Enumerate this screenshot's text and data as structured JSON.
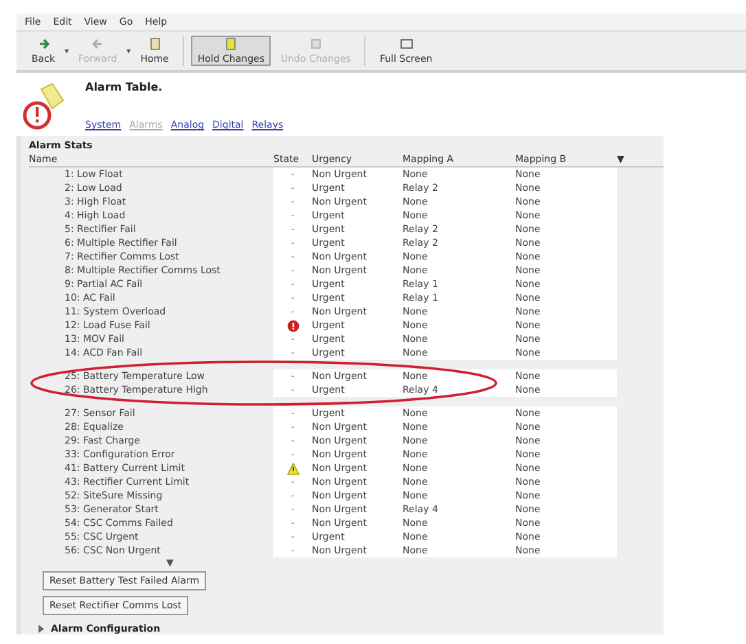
{
  "menu": [
    "File",
    "Edit",
    "View",
    "Go",
    "Help"
  ],
  "toolbar": [
    {
      "kind": "back",
      "label": "Back",
      "disabled": false,
      "pressed": false,
      "dropdown": "▾"
    },
    {
      "kind": "forward",
      "label": "Forward",
      "disabled": true,
      "pressed": false,
      "dropdown": "▾"
    },
    {
      "kind": "home",
      "label": "Home",
      "disabled": false,
      "pressed": false
    },
    {
      "kind": "hold",
      "label": "Hold Changes",
      "disabled": false,
      "pressed": true
    },
    {
      "kind": "undo",
      "label": "Undo Changes",
      "disabled": true,
      "pressed": false
    },
    {
      "kind": "fullscreen",
      "label": "Full Screen",
      "disabled": false,
      "pressed": false
    }
  ],
  "page": {
    "title": "Alarm Table.",
    "links": [
      {
        "label": "System",
        "selected": false
      },
      {
        "label": "Alarms",
        "selected": true
      },
      {
        "label": "Analog",
        "selected": false
      },
      {
        "label": "Digital",
        "selected": false
      },
      {
        "label": "Relays",
        "selected": false
      }
    ]
  },
  "section": "Alarm Stats",
  "columns": [
    "Name",
    "State",
    "Urgency",
    "Mapping A",
    "Mapping B"
  ],
  "sort_marker": "▼",
  "rows": [
    {
      "name": "1: Low Float",
      "kind": "text",
      "state": "-",
      "urgency": "Non Urgent",
      "mapping_a": "None",
      "mapping_b": "None",
      "circled": false
    },
    {
      "name": "2: Low Load",
      "kind": "text",
      "state": "-",
      "urgency": "Urgent",
      "mapping_a": "Relay 2",
      "mapping_b": "None",
      "circled": false
    },
    {
      "name": "3: High Float",
      "kind": "text",
      "state": "-",
      "urgency": "Non Urgent",
      "mapping_a": "None",
      "mapping_b": "None",
      "circled": false
    },
    {
      "name": "4: High Load",
      "kind": "text",
      "state": "-",
      "urgency": "Urgent",
      "mapping_a": "None",
      "mapping_b": "None",
      "circled": false
    },
    {
      "name": "5: Rectifier Fail",
      "kind": "text",
      "state": "-",
      "urgency": "Urgent",
      "mapping_a": "Relay 2",
      "mapping_b": "None",
      "circled": false
    },
    {
      "name": "6: Multiple Rectifier Fail",
      "kind": "text",
      "state": "-",
      "urgency": "Urgent",
      "mapping_a": "Relay 2",
      "mapping_b": "None",
      "circled": false
    },
    {
      "name": "7: Rectifier Comms Lost",
      "kind": "text",
      "state": "-",
      "urgency": "Non Urgent",
      "mapping_a": "None",
      "mapping_b": "None",
      "circled": false
    },
    {
      "name": "8: Multiple Rectifier Comms Lost",
      "kind": "text",
      "state": "-",
      "urgency": "Non Urgent",
      "mapping_a": "None",
      "mapping_b": "None",
      "circled": false
    },
    {
      "name": "9: Partial AC Fail",
      "kind": "text",
      "state": "-",
      "urgency": "Urgent",
      "mapping_a": "Relay 1",
      "mapping_b": "None",
      "circled": false
    },
    {
      "name": "10: AC Fail",
      "kind": "text",
      "state": "-",
      "urgency": "Urgent",
      "mapping_a": "Relay 1",
      "mapping_b": "None",
      "circled": false
    },
    {
      "name": "11: System Overload",
      "kind": "text",
      "state": "-",
      "urgency": "Non Urgent",
      "mapping_a": "None",
      "mapping_b": "None",
      "circled": false
    },
    {
      "name": "12: Load Fuse Fail",
      "kind": "alarm",
      "urgency": "Urgent",
      "mapping_a": "None",
      "mapping_b": "None",
      "circled": false
    },
    {
      "name": "13: MOV Fail",
      "kind": "text",
      "state": "-",
      "urgency": "Urgent",
      "mapping_a": "None",
      "mapping_b": "None",
      "circled": false
    },
    {
      "name": "14: ACD Fan Fail",
      "kind": "text",
      "state": "-",
      "urgency": "Urgent",
      "mapping_a": "None",
      "mapping_b": "None",
      "circled": false
    },
    {
      "name": "25: Battery Temperature Low",
      "kind": "text",
      "state": "-",
      "urgency": "Non Urgent",
      "mapping_a": "None",
      "mapping_b": "None",
      "circled": true
    },
    {
      "name": "26: Battery Temperature High",
      "kind": "text",
      "state": "-",
      "urgency": "Urgent",
      "mapping_a": "Relay 4",
      "mapping_b": "None",
      "circled": true
    },
    {
      "name": "27: Sensor Fail",
      "kind": "text",
      "state": "-",
      "urgency": "Urgent",
      "mapping_a": "None",
      "mapping_b": "None",
      "circled": false
    },
    {
      "name": "28: Equalize",
      "kind": "text",
      "state": "-",
      "urgency": "Non Urgent",
      "mapping_a": "None",
      "mapping_b": "None",
      "circled": false
    },
    {
      "name": "29: Fast Charge",
      "kind": "text",
      "state": "-",
      "urgency": "Non Urgent",
      "mapping_a": "None",
      "mapping_b": "None",
      "circled": false
    },
    {
      "name": "33: Configuration Error",
      "kind": "text",
      "state": "-",
      "urgency": "Non Urgent",
      "mapping_a": "None",
      "mapping_b": "None",
      "circled": false
    },
    {
      "name": "41: Battery Current Limit",
      "kind": "warning",
      "urgency": "Non Urgent",
      "mapping_a": "None",
      "mapping_b": "None",
      "circled": false
    },
    {
      "name": "43: Rectifier Current Limit",
      "kind": "text",
      "state": "-",
      "urgency": "Non Urgent",
      "mapping_a": "None",
      "mapping_b": "None",
      "circled": false
    },
    {
      "name": "52: SiteSure Missing",
      "kind": "text",
      "state": "-",
      "urgency": "Non Urgent",
      "mapping_a": "None",
      "mapping_b": "None",
      "circled": false
    },
    {
      "name": "53: Generator Start",
      "kind": "text",
      "state": "-",
      "urgency": "Non Urgent",
      "mapping_a": "Relay 4",
      "mapping_b": "None",
      "circled": false
    },
    {
      "name": "54: CSC Comms Failed",
      "kind": "text",
      "state": "-",
      "urgency": "Non Urgent",
      "mapping_a": "None",
      "mapping_b": "None",
      "circled": false
    },
    {
      "name": "55: CSC Urgent",
      "kind": "text",
      "state": "-",
      "urgency": "Urgent",
      "mapping_a": "None",
      "mapping_b": "None",
      "circled": false
    },
    {
      "name": "56: CSC Non Urgent",
      "kind": "text",
      "state": "-",
      "urgency": "Non Urgent",
      "mapping_a": "None",
      "mapping_b": "None",
      "circled": false
    }
  ],
  "more_marker": "▼",
  "buttons": [
    "Reset Battery Test Failed Alarm",
    "Reset Rectifier Comms Lost"
  ],
  "collapsed_section": {
    "label": "Alarm Configuration",
    "expanded": false
  }
}
